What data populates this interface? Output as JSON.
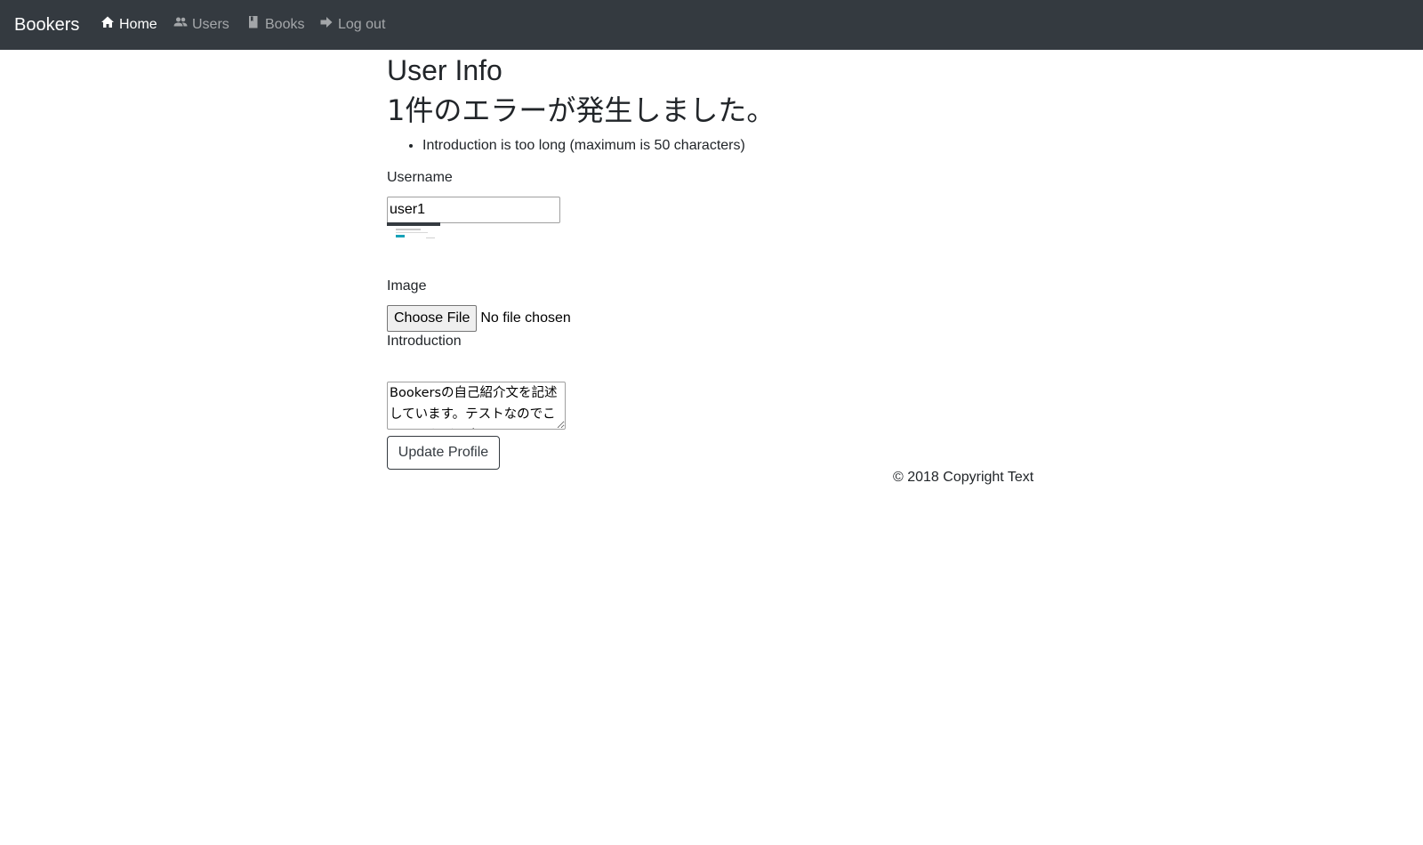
{
  "navbar": {
    "brand": "Bookers",
    "items": [
      {
        "label": "Home",
        "icon": "home-icon",
        "active": true
      },
      {
        "label": "Users",
        "icon": "users-icon",
        "active": false
      },
      {
        "label": "Books",
        "icon": "book-icon",
        "active": false
      },
      {
        "label": "Log out",
        "icon": "logout-arrow-icon",
        "active": false
      }
    ]
  },
  "page": {
    "title": "User Info",
    "error_heading": "1件のエラーが発生しました。",
    "errors": [
      "Introduction is too long (maximum is 50 characters)"
    ]
  },
  "form": {
    "username_label": "Username",
    "username_value": "user1",
    "image_label": "Image",
    "file_button": "Choose File",
    "file_status": "No file chosen",
    "introduction_label": "Introduction",
    "introduction_value": "Bookersの自己紹介文を記述しています。テストなのでこのような形で書いています。",
    "submit_label": "Update Profile"
  },
  "footer": {
    "copyright": "© 2018 Copyright Text"
  },
  "colors": {
    "navbar_bg": "#343a40",
    "nav_active": "#ffffff",
    "nav_inactive": "rgba(255,255,255,0.55)"
  }
}
